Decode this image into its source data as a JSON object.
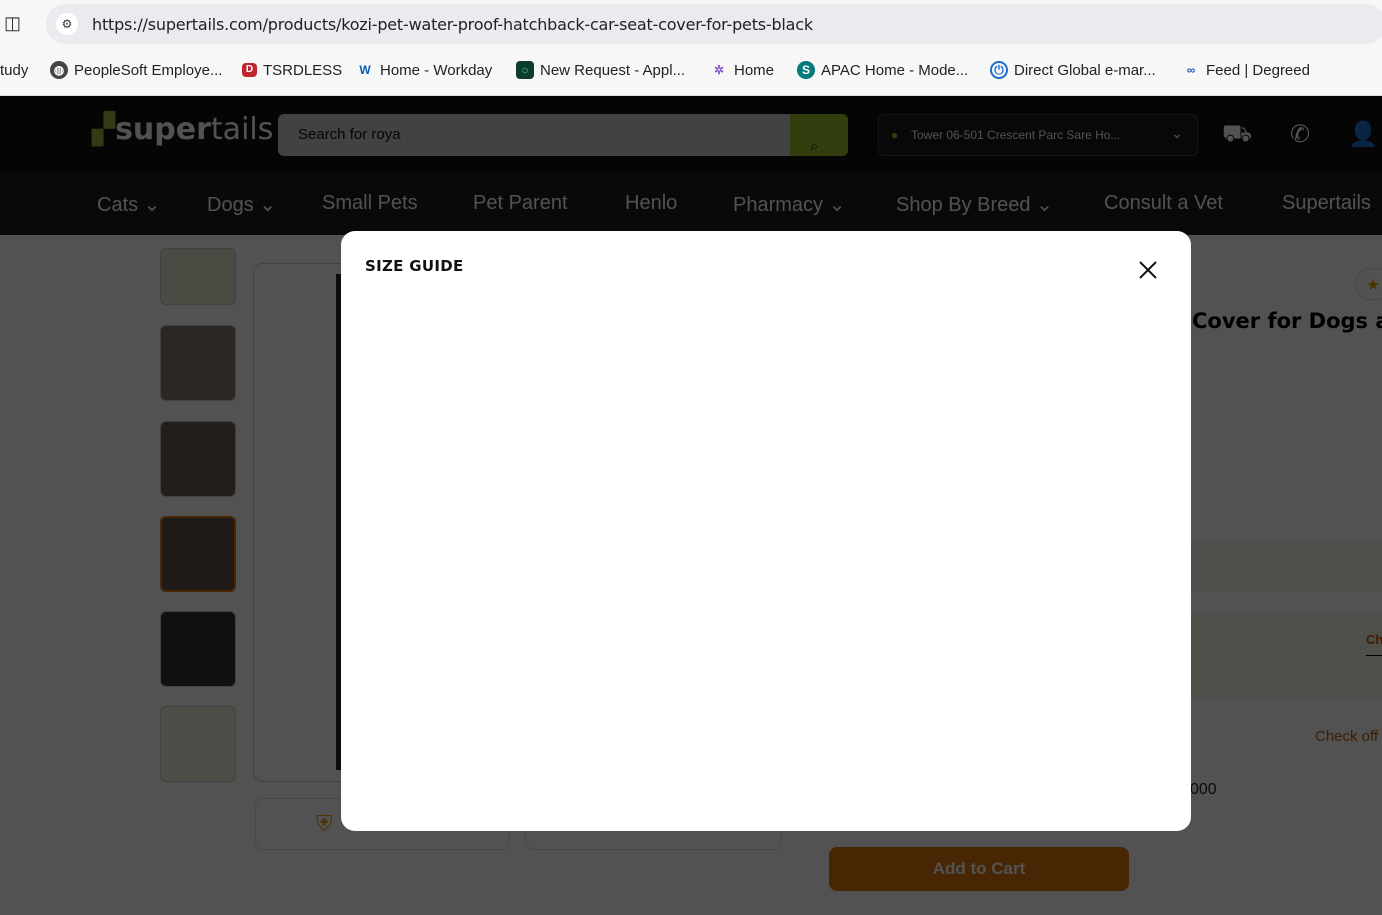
{
  "browser": {
    "url": "https://supertails.com/products/kozi-pet-water-proof-hatchback-car-seat-cover-for-pets-black",
    "bookmarks": [
      {
        "label": "tudy"
      },
      {
        "label": "PeopleSoft Employe..."
      },
      {
        "label": "TSRDLESS"
      },
      {
        "label": "Home - Workday"
      },
      {
        "label": "New Request - Appl..."
      },
      {
        "label": "Home"
      },
      {
        "label": "APAC Home - Mode..."
      },
      {
        "label": "Direct Global e-mar..."
      },
      {
        "label": "Feed | Degreed"
      }
    ]
  },
  "header": {
    "logo_prefix": "super",
    "logo_suffix": "tails",
    "search_placeholder": "Search for roya",
    "location": "Tower 06-501 Crescent Parc Sare Ho..."
  },
  "nav": [
    "Cats",
    "Dogs",
    "Small Pets",
    "Pet Parent",
    "Henlo",
    "Pharmacy",
    "Shop By Breed",
    "Consult a Vet",
    "Supertails"
  ],
  "product": {
    "title_fragment": "Cover for Dogs and",
    "check_label": "Ch",
    "check_offers": "Check off",
    "pincode_fragment": "000",
    "add_to_cart": "Add to Cart"
  },
  "modal": {
    "title": "SIZE GUIDE"
  },
  "colors": {
    "accent": "#9cbf2b",
    "cta": "#e2760e"
  }
}
